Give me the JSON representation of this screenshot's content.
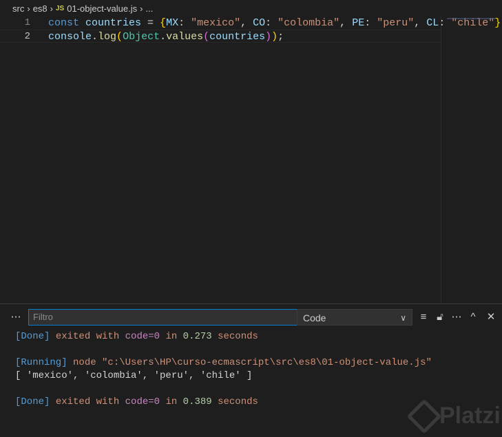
{
  "breadcrumb": {
    "items": [
      "src",
      "es8",
      "01-object-value.js",
      "..."
    ],
    "js_badge": "JS",
    "sep": "›"
  },
  "editor": {
    "lines": [
      {
        "num": "1",
        "tokens": [
          [
            "kw",
            "const "
          ],
          [
            "var",
            "countries"
          ],
          [
            "pl",
            " = "
          ],
          [
            "br",
            "{"
          ],
          [
            "var",
            "MX"
          ],
          [
            "pl",
            ": "
          ],
          [
            "str",
            "\"mexico\""
          ],
          [
            "pl",
            ", "
          ],
          [
            "var",
            "CO"
          ],
          [
            "pl",
            ": "
          ],
          [
            "str",
            "\"colombia\""
          ],
          [
            "pl",
            ", "
          ],
          [
            "var",
            "PE"
          ],
          [
            "pl",
            ": "
          ],
          [
            "str",
            "\"peru\""
          ],
          [
            "pl",
            ", "
          ],
          [
            "var",
            "CL"
          ],
          [
            "pl",
            ": "
          ],
          [
            "str",
            "\"chile\""
          ],
          [
            "br",
            "}"
          ]
        ]
      },
      {
        "num": "2",
        "tokens": [
          [
            "var",
            "console"
          ],
          [
            "pl",
            "."
          ],
          [
            "fn",
            "log"
          ],
          [
            "br",
            "("
          ],
          [
            "cls",
            "Object"
          ],
          [
            "pl",
            "."
          ],
          [
            "fn",
            "values"
          ],
          [
            "br2",
            "("
          ],
          [
            "var",
            "countries"
          ],
          [
            "br2",
            ")"
          ],
          [
            "br",
            ")"
          ],
          [
            "pl",
            ";"
          ]
        ]
      }
    ]
  },
  "panel": {
    "filter_placeholder": "Filtro",
    "channel": "Code",
    "output": [
      [
        [
          "ob",
          "[Done]"
        ],
        [
          "ot",
          " exited with "
        ],
        [
          "op",
          "code=0"
        ],
        [
          "ot",
          " in "
        ],
        [
          "og",
          "0.273"
        ],
        [
          "ot",
          " seconds"
        ]
      ],
      [],
      [
        [
          "ob",
          "[Running]"
        ],
        [
          "ot",
          " node \"c:\\Users\\HP\\curso-ecmascript\\src\\es8\\01-object-value.js\""
        ]
      ],
      [
        [
          "ow",
          "[ 'mexico', 'colombia', 'peru', 'chile' ]"
        ]
      ],
      [],
      [
        [
          "ob",
          "[Done]"
        ],
        [
          "ot",
          " exited with "
        ],
        [
          "op",
          "code=0"
        ],
        [
          "ot",
          " in "
        ],
        [
          "og",
          "0.389"
        ],
        [
          "ot",
          " seconds"
        ]
      ]
    ]
  },
  "watermark": "Platzi"
}
